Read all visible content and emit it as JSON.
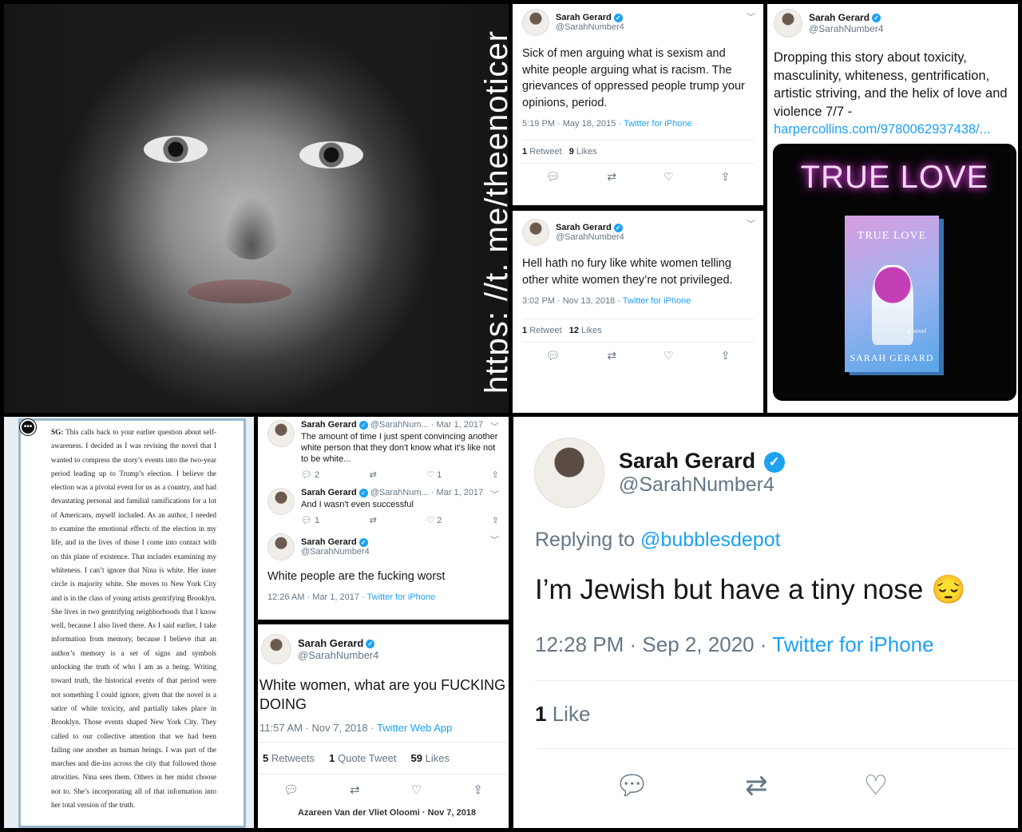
{
  "watermark": "https: //t. me/theenoticer",
  "tweet1": {
    "name": "Sarah Gerard",
    "handle": "@SarahNumber4",
    "text": "Sick of men arguing what is sexism and white people arguing what is racism. The grievances of oppressed people trump your opinions, period.",
    "time": "5:19 PM · May 18, 2015 · ",
    "via": "Twitter for iPhone",
    "rt_n": "1",
    "rt_l": "Retweet",
    "likes_n": "9",
    "likes_l": "Likes"
  },
  "tweet2": {
    "name": "Sarah Gerard",
    "handle": "@SarahNumber4",
    "text": "Hell hath no fury like white women telling other white women they’re not privileged.",
    "time": "3:02 PM · Nov 13, 2018 · ",
    "via": "Twitter for iPhone",
    "rt_n": "1",
    "rt_l": "Retweet",
    "likes_n": "12",
    "likes_l": "Likes"
  },
  "tweet3": {
    "name": "Sarah Gerard",
    "handle": "@SarahNumber4",
    "text": "Dropping this story about toxicity, masculinity, whiteness, gentrification, artistic striving, and the helix of love and violence 7/7 -",
    "link": "harpercollins.com/9780062937438/...",
    "sign_title": "TRUE LOVE",
    "cover_title": "TRUE LOVE",
    "cover_sub": "a novel",
    "cover_author": "SARAH GERARD"
  },
  "doc": {
    "label": "SG:",
    "text": "This calls back to your earlier question about self-awareness. I decided as I was revising the novel that I wanted to compress the story’s events into the two-year period leading up to Trump’s election. I believe the election was a pivotal event for us as a country, and had devastating personal and familial ramifications for a lot of Americans, myself included. As an author, I needed to examine the emotional effects of the election in my life, and in the lives of those I come into contact with on this plane of existence. That includes examining my whiteness. I can’t ignore that Nina is white. Her inner circle is majority white. She moves to New York City and is in the class of young artists gentrifying Brooklyn. She lives in two gentrifying neighborhoods that I know well, because I also lived there. As I said earlier, I take information from memory, because I believe that an author’s memory is a set of signs and symbols unlocking the truth of who I am as a being. Writing toward truth, the historical events of that period were not something I could ignore, given that the novel is a satire of white toxicity, and partially takes place in Brooklyn. Those events shaped New York City. They called to our collective attention that we had been failing one another as human beings. I was part of the marches and die-ins across the city that followed those atrocities. Nina sees them. Others in her midst choose not to. She’s incorporating all of that information into her total version of the truth."
  },
  "thread": {
    "a": {
      "name": "Sarah Gerard",
      "handle": "@SarahNum...",
      "date": "· Mar 1, 2017",
      "text": "The amount of time I just spent convincing another white person that they don't know what it's like not to be white...",
      "reply": "2",
      "like": "1"
    },
    "b": {
      "name": "Sarah Gerard",
      "handle": "@SarahNum...",
      "date": "· Mar 1, 2017",
      "text": "And I wasn't even successful",
      "reply": "1",
      "like": "2"
    },
    "c": {
      "name": "Sarah Gerard",
      "handle": "@SarahNumber4",
      "text": "White people are the fucking worst",
      "time": "12:26 AM · Mar 1, 2017 · ",
      "via": "Twitter for iPhone"
    }
  },
  "tweet5": {
    "name": "Sarah Gerard",
    "handle": "@SarahNumber4",
    "text": "White women, what are you FUCKING DOING",
    "time": "11:57 AM · Nov 7, 2018 · ",
    "via": "Twitter Web App",
    "rt_n": "5",
    "rt_l": "Retweets",
    "q_n": "1",
    "q_l": "Quote Tweet",
    "likes_n": "59",
    "likes_l": "Likes",
    "next": "Azareen Van der Vliet Oloomi · Nov 7, 2018"
  },
  "tweet6": {
    "name": "Sarah Gerard",
    "handle": "@SarahNumber4",
    "replying": "Replying to ",
    "replying_to": "@bubblesdepot",
    "text": "I’m Jewish but have a tiny nose 😔",
    "time": "12:28 PM · Sep 2, 2020 · ",
    "via": "Twitter for iPhone",
    "likes_n": "1",
    "likes_l": "Like"
  }
}
